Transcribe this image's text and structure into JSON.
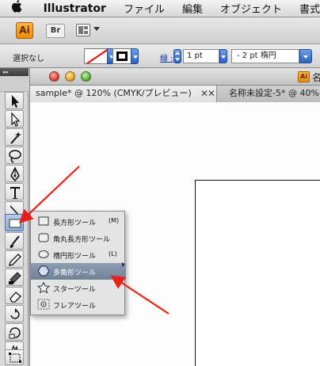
{
  "menubar": {
    "apple": "",
    "app_name": "Illustrator",
    "items": [
      "ファイル",
      "編集",
      "オブジェクト",
      "書式"
    ]
  },
  "apptoolbar": {
    "app_badge": "Ai",
    "bridge_label": "Br"
  },
  "controlbar": {
    "selection_label": "選択なし",
    "stroke_label": "線 :",
    "stroke_weight": "1 pt",
    "brush_label": "-   2 pt 楕円"
  },
  "document": {
    "title_badge": "Ai",
    "title_text": "名",
    "tabs": [
      {
        "label": "sample* @ 120% (CMYK/プレビュー)",
        "close": "✕"
      },
      {
        "label": "名称未設定-5* @ 40% (C",
        "close": "✕"
      }
    ]
  },
  "flyout": {
    "items": [
      {
        "label": "長方形ツール",
        "shortcut": "(M)",
        "icon": "rectangle-icon"
      },
      {
        "label": "角丸長方形ツール",
        "shortcut": "",
        "icon": "rounded-rectangle-icon"
      },
      {
        "label": "楕円形ツール",
        "shortcut": "(L)",
        "icon": "ellipse-icon"
      },
      {
        "label": "多角形ツール",
        "shortcut": "",
        "icon": "polygon-icon"
      },
      {
        "label": "スターツール",
        "shortcut": "",
        "icon": "star-icon"
      },
      {
        "label": "フレアツール",
        "shortcut": "",
        "icon": "flare-icon"
      }
    ],
    "active_index": 3
  },
  "colors": {
    "accent_orange": "#f08c00",
    "annotation_arrow": "#e8201a",
    "selection_blue": "#2d62c4"
  }
}
